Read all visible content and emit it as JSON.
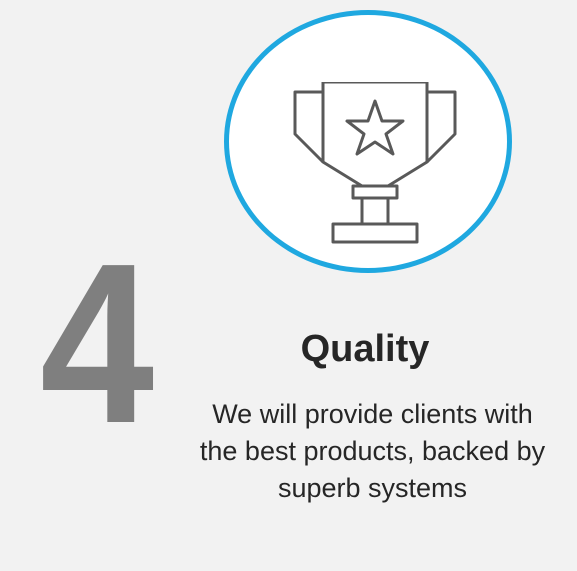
{
  "card": {
    "number": "4",
    "title": "Quality",
    "description": "We will provide clients with the best products, backed by superb systems",
    "icon": "trophy-star-icon"
  },
  "colors": {
    "background": "#f2f2f2",
    "circle_border": "#1fa8e0",
    "number": "#7f7f7f",
    "text": "#262626",
    "icon_stroke": "#595959"
  }
}
